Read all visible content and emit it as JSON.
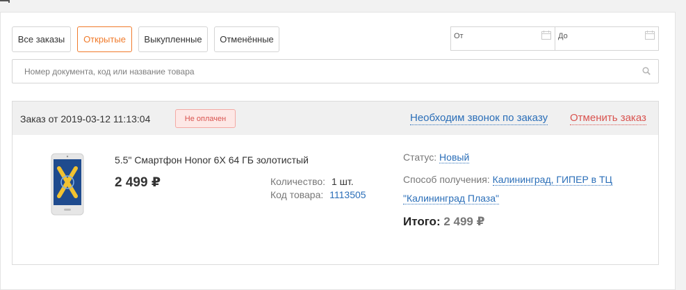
{
  "filters": {
    "tabs": [
      {
        "label": "Все заказы",
        "active": false
      },
      {
        "label": "Открытые",
        "active": true
      },
      {
        "label": "Выкупленные",
        "active": false
      },
      {
        "label": "Отменённые",
        "active": false
      }
    ],
    "date_from_placeholder": "От",
    "date_to_placeholder": "До"
  },
  "search": {
    "placeholder": "Номер документа, код или название товара",
    "value": ""
  },
  "order": {
    "title": "Заказ от 2019-03-12 11:13:04",
    "payment_badge": "Не оплачен",
    "call_link": "Необходим звонок по заказу",
    "cancel_link": "Отменить заказ",
    "product": {
      "name": "5.5\" Смартфон Honor 6X 64 ГБ золотистый",
      "price": "2 499 ₽",
      "quantity_label": "Количество:",
      "quantity_value": "1 шт.",
      "code_label": "Код товара:",
      "code_value": "1113505"
    },
    "status_label": "Статус:",
    "status_value": "Новый",
    "delivery_label": "Способ получения:",
    "delivery_value": "Калининград, ГИПЕР в ТЦ \"Калининград Плаза\"",
    "total_label": "Итого:",
    "total_value": "2 499 ₽"
  },
  "colors": {
    "accent_orange": "#f07a2a",
    "link_blue": "#2a6eb8",
    "danger_red": "#d9534f",
    "badge_bg": "#fde8e6"
  }
}
